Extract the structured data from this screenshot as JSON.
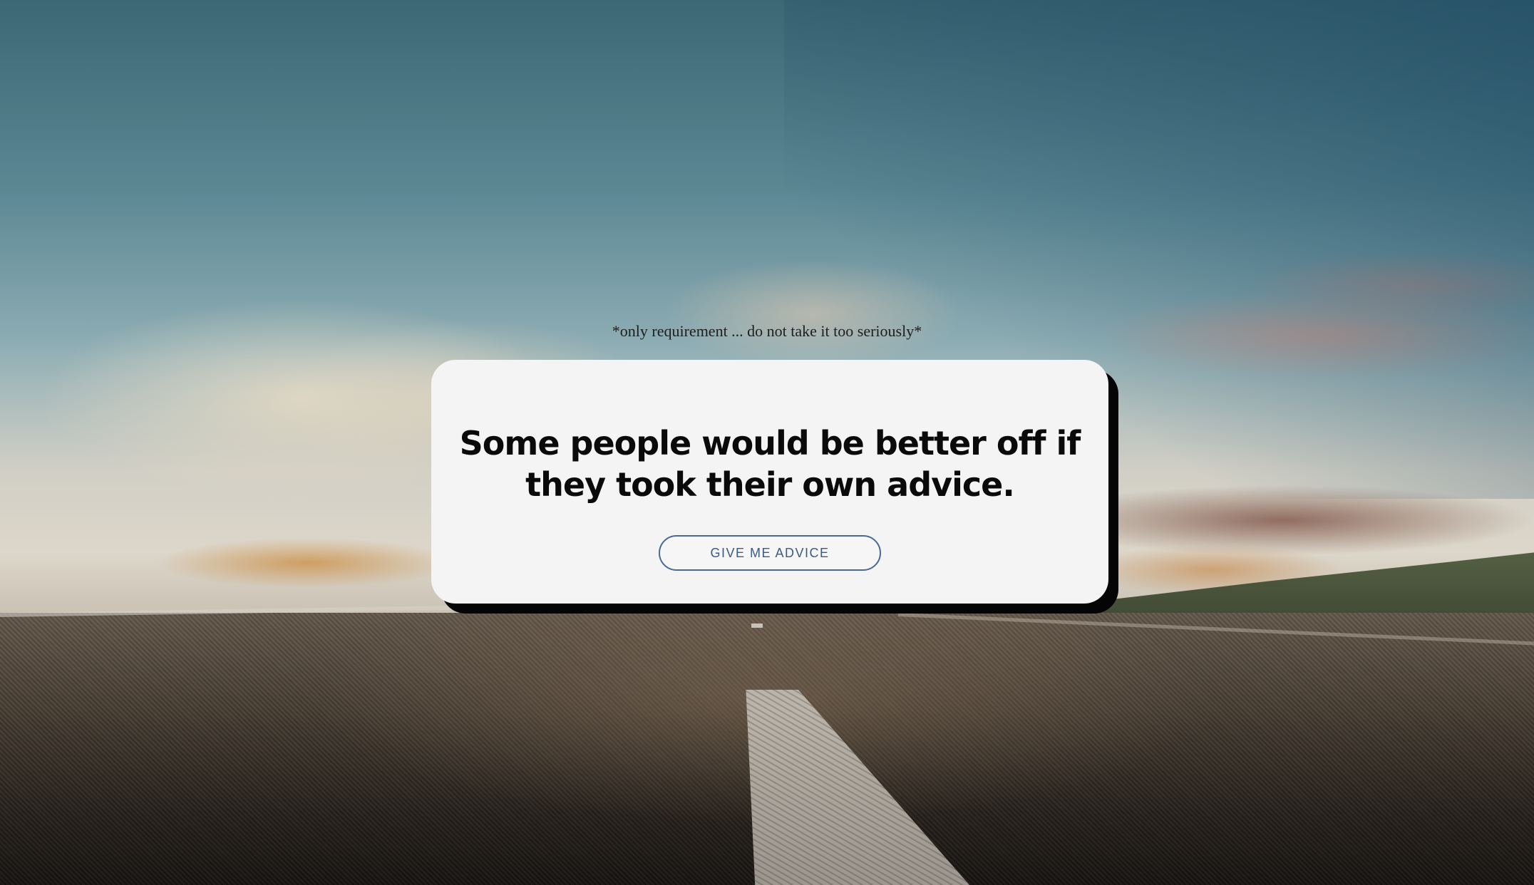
{
  "background": {
    "description_icon": "road-landscape-background"
  },
  "note": {
    "text": "*only requirement ... do not take it too seriously*"
  },
  "card": {
    "quote": "Some people would be better off if they took their own advice.",
    "button_label": "GIVE ME ADVICE"
  },
  "colors": {
    "card_background": "#f4f4f4",
    "card_shadow": "#050505",
    "button_border": "#4a6a93",
    "button_text": "#3b5a84",
    "quote_text": "#0a0a0a"
  }
}
